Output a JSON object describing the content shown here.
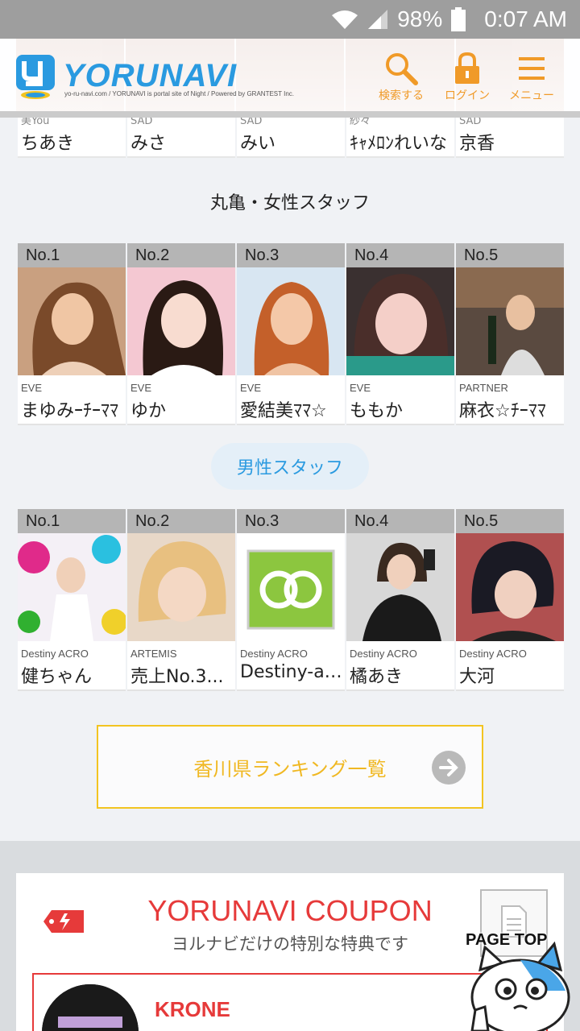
{
  "status_bar": {
    "battery": "98%",
    "time": "0:07 AM"
  },
  "header": {
    "logo_text": "YORUNAVI",
    "logo_sub": "yo-ru-navi.com / YORUNAVI is portal site of Night / Powered by GRANTEST Inc.",
    "search_label": "検索する",
    "login_label": "ログイン",
    "menu_label": "メニュー"
  },
  "top_row": [
    {
      "shop": "美You",
      "name": "ちあき"
    },
    {
      "shop": "SAD",
      "name": "みさ"
    },
    {
      "shop": "SAD",
      "name": "みい"
    },
    {
      "shop": "紗々",
      "name": "ｷｬﾒﾛﾝれいな"
    },
    {
      "shop": "SAD",
      "name": "京香"
    }
  ],
  "female_section": {
    "title": "丸亀・女性スタッフ",
    "items": [
      {
        "rank": "No.1",
        "shop": "EVE",
        "name": "まゆみｰﾁｰﾏﾏ"
      },
      {
        "rank": "No.2",
        "shop": "EVE",
        "name": "ゆか"
      },
      {
        "rank": "No.3",
        "shop": "EVE",
        "name": "愛結美ﾏﾏ☆"
      },
      {
        "rank": "No.4",
        "shop": "EVE",
        "name": "ももか"
      },
      {
        "rank": "No.5",
        "shop": "PARTNER",
        "name": "麻衣☆ﾁｰﾏﾏ"
      }
    ]
  },
  "male_section": {
    "title": "男性スタッフ",
    "items": [
      {
        "rank": "No.1",
        "shop": "Destiny ACRO",
        "name": "健ちゃん"
      },
      {
        "rank": "No.2",
        "shop": "ARTEMIS",
        "name": "売上No.3..."
      },
      {
        "rank": "No.3",
        "shop": "Destiny ACRO",
        "name": "Destiny-acro"
      },
      {
        "rank": "No.4",
        "shop": "Destiny ACRO",
        "name": "橘あき"
      },
      {
        "rank": "No.5",
        "shop": "Destiny ACRO",
        "name": "大河"
      }
    ]
  },
  "ranking_link": {
    "label": "香川県ランキング一覧"
  },
  "coupon": {
    "title": "YORUNAVI COUPON",
    "subtitle": "ヨルナビだけの特別な特典です",
    "shop_name": "KRONE"
  },
  "page_top": {
    "label": "PAGE TOP"
  },
  "colors": {
    "accent_blue": "#2a9ae0",
    "accent_orange": "#f09a28",
    "coupon_red": "#e63a3a",
    "link_yellow": "#f2c421"
  }
}
